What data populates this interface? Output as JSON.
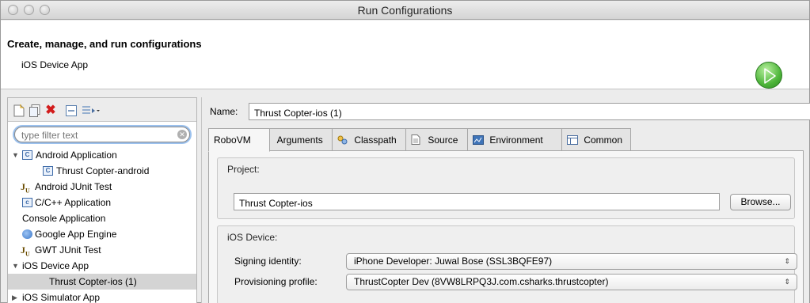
{
  "window": {
    "title": "Run Configurations"
  },
  "header": {
    "title": "Create, manage, and run configurations",
    "subtitle": "iOS Device App"
  },
  "left": {
    "filter_placeholder": "type filter text",
    "tree": [
      {
        "label": "Android Application",
        "icon": "android-app-icon",
        "level": 0,
        "expanded": true
      },
      {
        "label": "Thrust Copter-android",
        "icon": "android-app-icon",
        "level": 1
      },
      {
        "label": "Android JUnit Test",
        "icon": "junit-icon",
        "level": 0
      },
      {
        "label": "C/C++ Application",
        "icon": "c-app-icon",
        "level": 0
      },
      {
        "label": "Console Application",
        "icon": "",
        "level": 0
      },
      {
        "label": "Google App Engine",
        "icon": "app-engine-icon",
        "level": 0
      },
      {
        "label": "GWT JUnit Test",
        "icon": "junit-icon",
        "level": 0
      },
      {
        "label": "iOS Device App",
        "icon": "",
        "level": 0,
        "expanded": true
      },
      {
        "label": "Thrust Copter-ios (1)",
        "icon": "",
        "level": 1,
        "selected": true
      },
      {
        "label": "iOS Simulator App",
        "icon": "",
        "level": 0,
        "expanded": false
      }
    ]
  },
  "right": {
    "name_label": "Name:",
    "name_value": "Thrust Copter-ios (1)",
    "tabs": [
      {
        "label": "RoboVM",
        "icon": "",
        "active": true
      },
      {
        "label": "Arguments",
        "icon": "arguments-icon"
      },
      {
        "label": "Classpath",
        "icon": "classpath-icon"
      },
      {
        "label": "Source",
        "icon": "source-icon"
      },
      {
        "label": "Environment",
        "icon": "environment-icon"
      },
      {
        "label": "Common",
        "icon": "common-icon"
      }
    ],
    "project_group": {
      "title": "Project:",
      "value": "Thrust Copter-ios",
      "browse_label": "Browse..."
    },
    "device_group": {
      "title": "iOS Device:",
      "signing_label": "Signing identity:",
      "signing_value": "iPhone Developer: Juwal Bose (SSL3BQFE97)",
      "provisioning_label": "Provisioning profile:",
      "provisioning_value": "ThrustCopter Dev (8VW8LRPQ3J.com.csharks.thrustcopter)"
    }
  },
  "colors": {
    "accent_focus": "#9bc1ee",
    "run_green": "#4eb53a",
    "selection": "#d4d4d4"
  }
}
